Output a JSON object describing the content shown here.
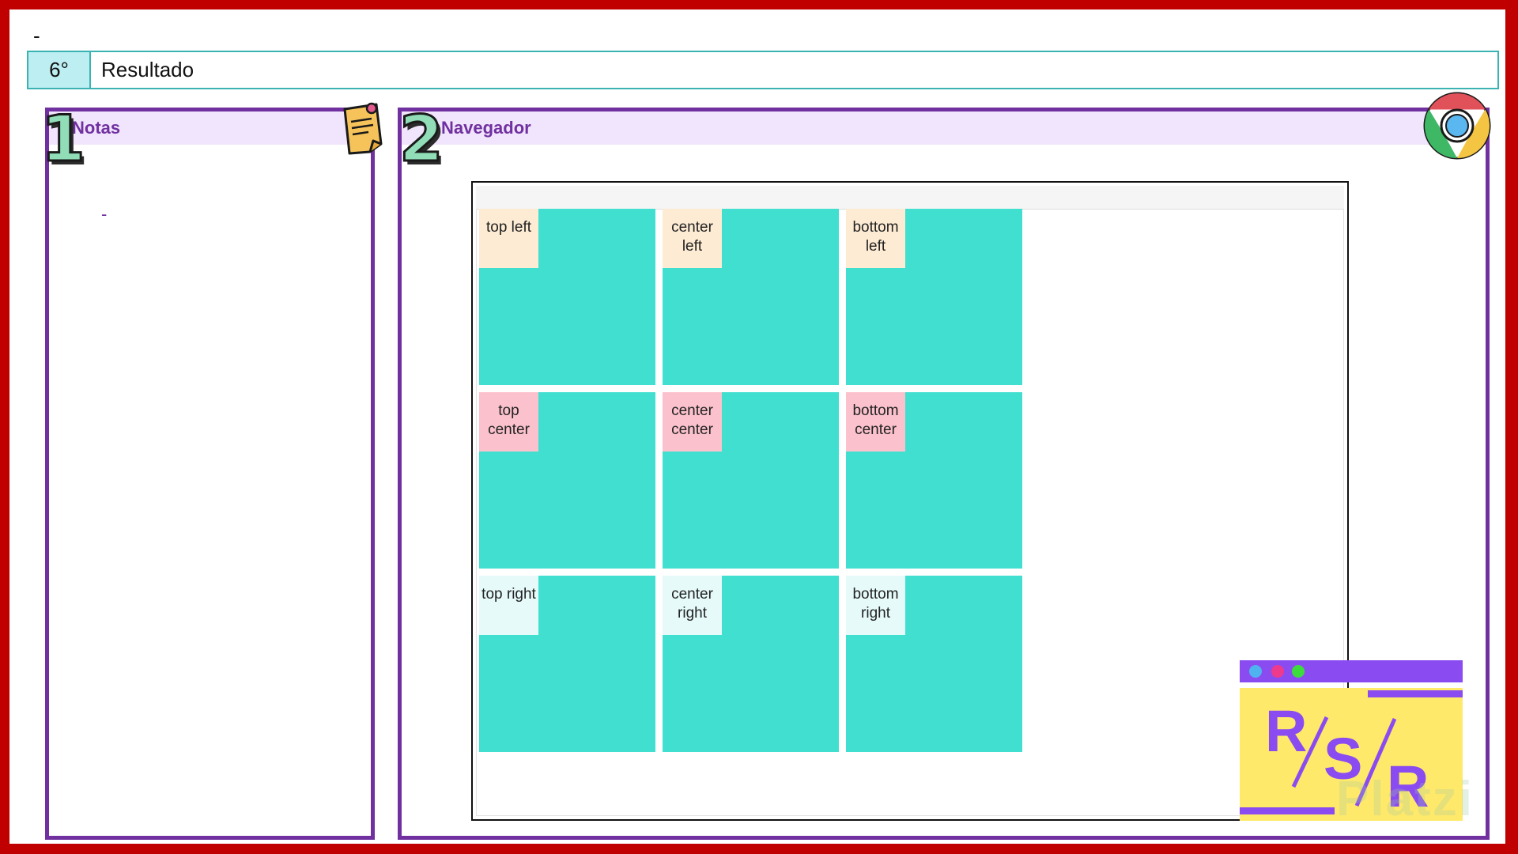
{
  "slide": {
    "top_dash": "-",
    "header": {
      "number": "6°",
      "title": "Resultado"
    }
  },
  "panels": {
    "notes": {
      "number": "1",
      "title": "Notas",
      "content": "-"
    },
    "browser": {
      "number": "2",
      "title": "Navegador"
    }
  },
  "grid": {
    "cells": [
      {
        "label": "top left",
        "tone": "orange"
      },
      {
        "label": "center left",
        "tone": "orange"
      },
      {
        "label": "bottom left",
        "tone": "orange"
      },
      {
        "label": "top center",
        "tone": "pink"
      },
      {
        "label": "center center",
        "tone": "pink"
      },
      {
        "label": "bottom center",
        "tone": "pink"
      },
      {
        "label": "top right",
        "tone": "cyan"
      },
      {
        "label": "center right",
        "tone": "cyan"
      },
      {
        "label": "bottom right",
        "tone": "cyan"
      }
    ]
  },
  "logo": {
    "letters": [
      "R",
      "S",
      "R"
    ],
    "watermark": "Platzi"
  },
  "colors": {
    "frame": "#c00000",
    "panel_border": "#7030a0",
    "panel_head_bg": "#f1e5fd",
    "cell_bg": "#40dfd0",
    "label_orange": "#fdebd3",
    "label_pink": "#fbc1cc",
    "label_cyan": "#e6fafa",
    "header_border": "#3bb3b3"
  },
  "icons": [
    "sticky-note-icon",
    "chrome-icon",
    "rsr-logo"
  ]
}
